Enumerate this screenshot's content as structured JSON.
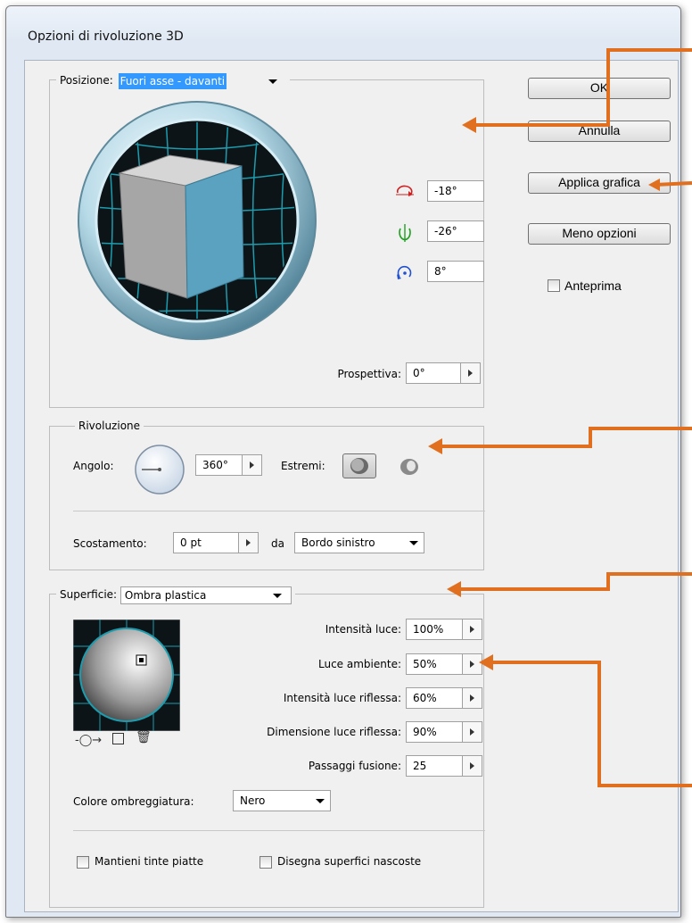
{
  "window": {
    "title": "Opzioni di rivoluzione 3D"
  },
  "position": {
    "label": "Posizione:",
    "selected": "Fuori asse - davanti",
    "rotation_x": "-18°",
    "rotation_y": "-26°",
    "rotation_z": "8°",
    "perspective_label": "Prospettiva:",
    "perspective_value": "0°"
  },
  "buttons": {
    "ok": "OK",
    "cancel": "Annulla",
    "map_art": "Applica grafica",
    "fewer_options": "Meno opzioni",
    "preview": "Anteprima"
  },
  "revolve": {
    "title": "Rivoluzione",
    "angle_label": "Angolo:",
    "angle_value": "360°",
    "caps_label": "Estremi:",
    "offset_label": "Scostamento:",
    "offset_value": "0 pt",
    "from_label": "da",
    "from_value": "Bordo sinistro"
  },
  "surface": {
    "label": "Superficie:",
    "selected": "Ombra plastica",
    "light_intensity_label": "Intensità luce:",
    "light_intensity_value": "100%",
    "ambient_light_label": "Luce ambiente:",
    "ambient_light_value": "50%",
    "highlight_intensity_label": "Intensità luce riflessa:",
    "highlight_intensity_value": "60%",
    "highlight_size_label": "Dimensione luce riflessa:",
    "highlight_size_value": "90%",
    "blend_steps_label": "Passaggi fusione:",
    "blend_steps_value": "25",
    "shading_color_label": "Colore ombreggiatura:",
    "shading_color_value": "Nero",
    "preserve_spot_label": "Mantieni tinte piatte",
    "draw_hidden_label": "Disegna superfici nascoste"
  },
  "colors": {
    "accent": "#e07020",
    "cube_front": "#5aa2c0",
    "track_ring": "#9cd0e0"
  }
}
